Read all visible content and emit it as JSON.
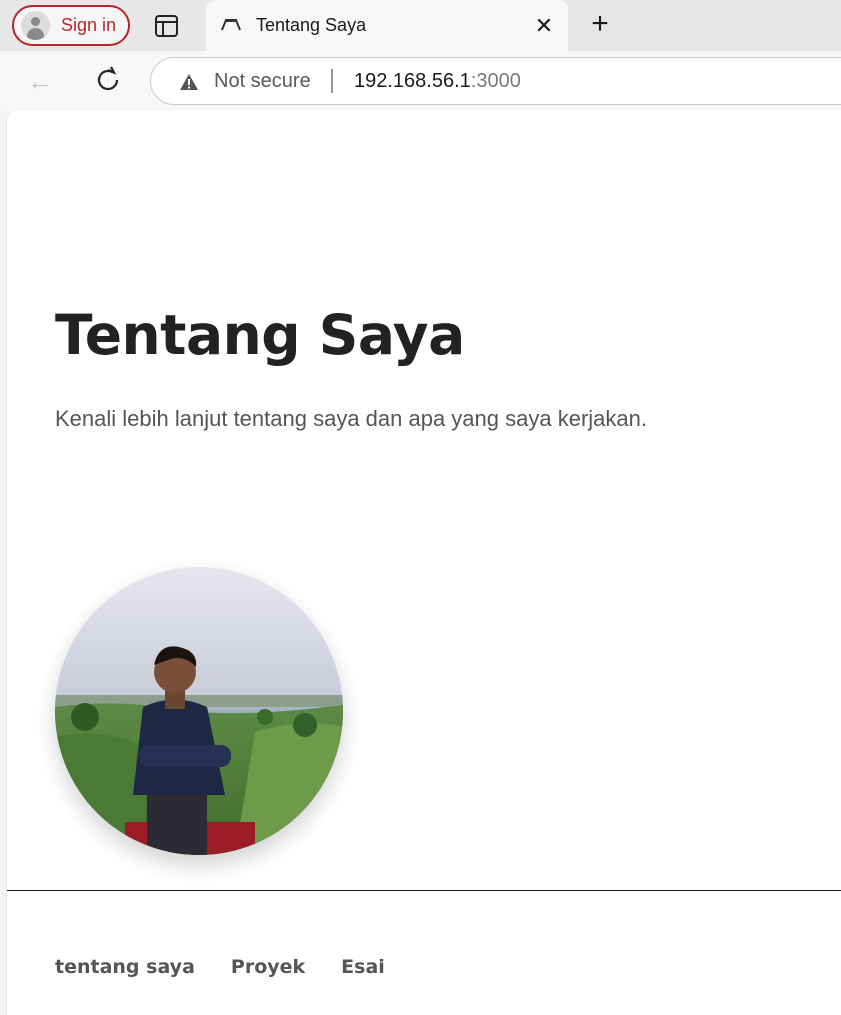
{
  "browser": {
    "signin_label": "Sign in",
    "tab_title": "Tentang Saya",
    "security_label": "Not secure",
    "url_host": "192.168.56.1",
    "url_port": ":3000"
  },
  "page": {
    "heading": "Tentang Saya",
    "subtitle": "Kenali lebih lanjut tentang saya dan apa yang saya kerjakan.",
    "nav": [
      "tentang saya",
      "Proyek",
      "Esai"
    ]
  },
  "colors": {
    "signin_accent": "#b5262b",
    "heading": "#222222",
    "body_text": "#555555"
  }
}
